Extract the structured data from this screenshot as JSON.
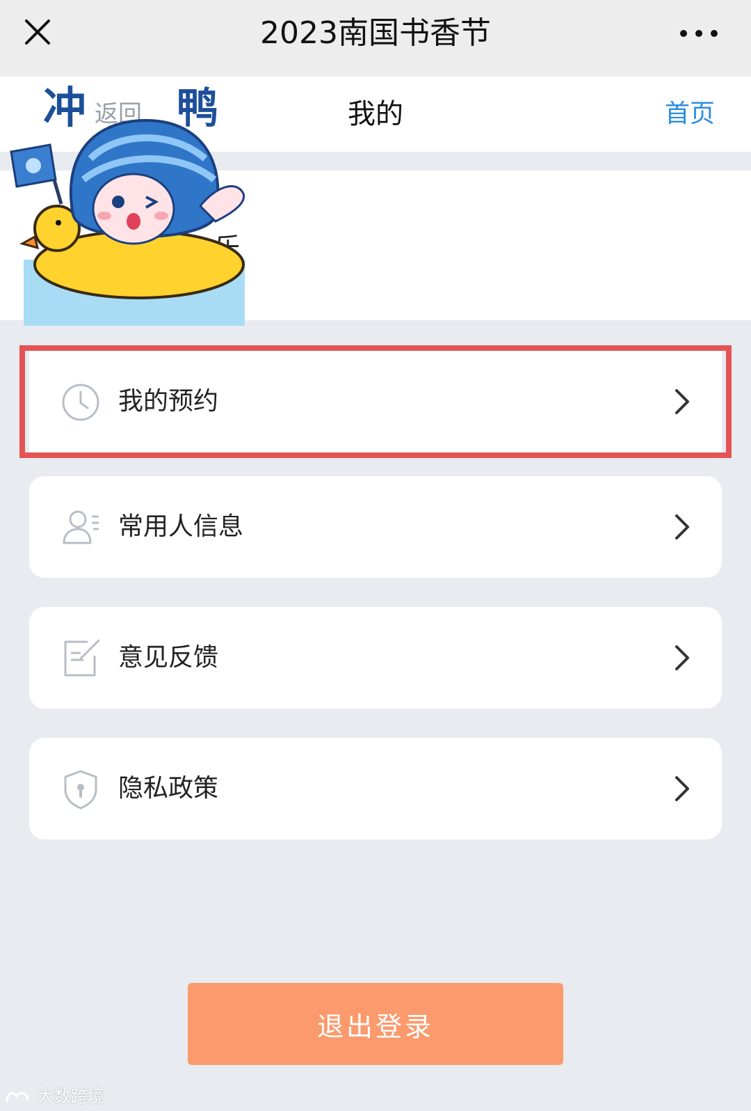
{
  "window": {
    "title": "2023南国书香节"
  },
  "nav": {
    "back_label": "返回",
    "page_title": "我的",
    "home_label": "首页"
  },
  "profile": {
    "name_fragment": "乐"
  },
  "sticker": {
    "text_left": "冲",
    "text_right": "鸭"
  },
  "menu": {
    "items": [
      {
        "label": "我的预约",
        "icon": "clock-icon",
        "highlighted": true
      },
      {
        "label": "常用人信息",
        "icon": "contact-person-icon",
        "highlighted": false
      },
      {
        "label": "意见反馈",
        "icon": "feedback-edit-icon",
        "highlighted": false
      },
      {
        "label": "隐私政策",
        "icon": "shield-lock-icon",
        "highlighted": false
      }
    ]
  },
  "logout": {
    "label": "退出登录"
  },
  "watermark": {
    "text": "大数跨境"
  },
  "colors": {
    "accent_link": "#2b8ede",
    "logout_button": "#fb9a6c",
    "highlight_border": "#e45454",
    "page_background": "#e8ebf0"
  }
}
